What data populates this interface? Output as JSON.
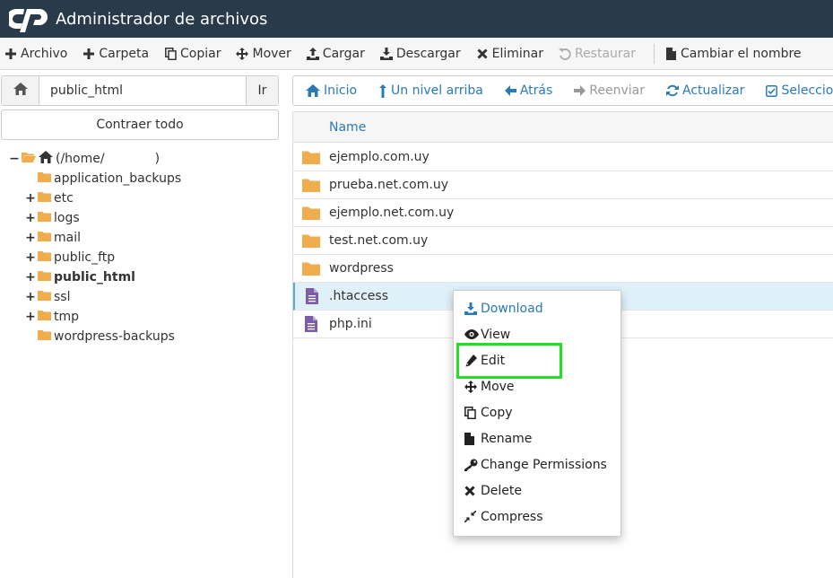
{
  "header": {
    "title": "Administrador de archivos",
    "logo": "cpanel-logo"
  },
  "toolbar": {
    "archivo": "Archivo",
    "carpeta": "Carpeta",
    "copiar": "Copiar",
    "mover": "Mover",
    "cargar": "Cargar",
    "descargar": "Descargar",
    "eliminar": "Eliminar",
    "restaurar": "Restaurar",
    "cambiar_nombre": "Cambiar el nombre"
  },
  "path": {
    "value": "public_html",
    "go_label": "Ir"
  },
  "collapse_label": "Contraer todo",
  "tree": {
    "root_label": "(/home/",
    "root_close": ")",
    "items": [
      {
        "label": "application_backups",
        "expandable": false,
        "bold": false
      },
      {
        "label": "etc",
        "expandable": true,
        "bold": false
      },
      {
        "label": "logs",
        "expandable": true,
        "bold": false
      },
      {
        "label": "mail",
        "expandable": true,
        "bold": false
      },
      {
        "label": "public_ftp",
        "expandable": true,
        "bold": false
      },
      {
        "label": "public_html",
        "expandable": true,
        "bold": true
      },
      {
        "label": "ssl",
        "expandable": true,
        "bold": false
      },
      {
        "label": "tmp",
        "expandable": true,
        "bold": false
      },
      {
        "label": "wordpress-backups",
        "expandable": false,
        "bold": false
      }
    ]
  },
  "nav": {
    "inicio": "Inicio",
    "nivel_arriba": "Un nivel arriba",
    "atras": "Atrás",
    "reenviar": "Reenviar",
    "actualizar": "Actualizar",
    "seleccione": "Seleccione T"
  },
  "file_table": {
    "name_header": "Name",
    "rows": [
      {
        "name": "ejemplo.com.uy",
        "type": "folder"
      },
      {
        "name": "prueba.net.com.uy",
        "type": "folder"
      },
      {
        "name": "ejemplo.net.com.uy",
        "type": "folder"
      },
      {
        "name": "test.net.com.uy",
        "type": "folder"
      },
      {
        "name": "wordpress",
        "type": "folder"
      },
      {
        "name": ".htaccess",
        "type": "file"
      },
      {
        "name": "php.ini",
        "type": "file"
      }
    ]
  },
  "context_menu": {
    "download": "Download",
    "view": "View",
    "edit": "Edit",
    "move": "Move",
    "copy": "Copy",
    "rename": "Rename",
    "change_permissions": "Change Permissions",
    "delete": "Delete",
    "compress": "Compress"
  },
  "colors": {
    "header_bg": "#293a4a",
    "link_blue": "#2a7ab8",
    "folder_orange": "#f0ad4e",
    "file_purple": "#7b5ea7",
    "highlight_green": "#22e022",
    "selected_row": "#dff0f8"
  }
}
